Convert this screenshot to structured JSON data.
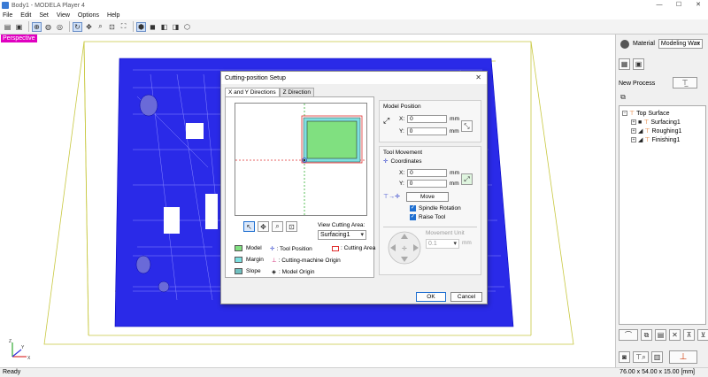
{
  "window": {
    "title": "Body1 - MODELA Player 4",
    "controls": [
      "—",
      "☐",
      "✕"
    ]
  },
  "menu": [
    "File",
    "Edit",
    "Set",
    "View",
    "Options",
    "Help"
  ],
  "viewport": {
    "mode_label": "Perspective"
  },
  "panel": {
    "material_label": "Material",
    "material_value": "Modeling Wax",
    "new_process_label": "New Process",
    "tree": {
      "root": "Top Surface",
      "items": [
        "Surfacing1",
        "Roughing1",
        "Finishing1"
      ]
    }
  },
  "status": {
    "left": "Ready",
    "right": "76.00 x 54.00 x 15.00 [mm]"
  },
  "dialog": {
    "title": "Cutting-position Setup",
    "close": "✕",
    "tabs": [
      "X and Y Directions",
      "Z Direction"
    ],
    "view_cutting_area_label": "View Cutting Area:",
    "view_cutting_area_value": "Surfacing1",
    "legend": {
      "model": "Model",
      "margin": "Margin",
      "slope": "Slope",
      "tool_position": ": Tool Position",
      "cutting_machine_origin": ": Cutting-machine Origin",
      "model_origin": ": Model Origin",
      "cutting_area": ": Cutting Area"
    },
    "model_position": {
      "title": "Model Position",
      "x_label": "X:",
      "x_value": "0",
      "x_unit": "mm",
      "y_label": "Y:",
      "y_value": "0",
      "y_unit": "mm"
    },
    "tool_movement": {
      "title": "Tool Movement",
      "coordinates_label": "Coordinates",
      "x_label": "X:",
      "x_value": "0",
      "x_unit": "mm",
      "y_label": "Y:",
      "y_value": "0",
      "y_unit": "mm",
      "move_button": "Move",
      "spindle_rotation": "Spindle Rotation",
      "raise_tool": "Raise Tool",
      "movement_unit_label": "Movement Unit",
      "movement_unit_value": "0.1",
      "movement_unit_unit": "mm"
    },
    "ok": "OK",
    "cancel": "Cancel"
  },
  "colors": {
    "model_green": "#80e080",
    "margin_cyan": "#7de0e0",
    "slope_teal": "#70c0c0",
    "wire_blue": "#1a1aff",
    "perspective_badge": "#e000c0",
    "cutting_area_red": "#e03030"
  }
}
